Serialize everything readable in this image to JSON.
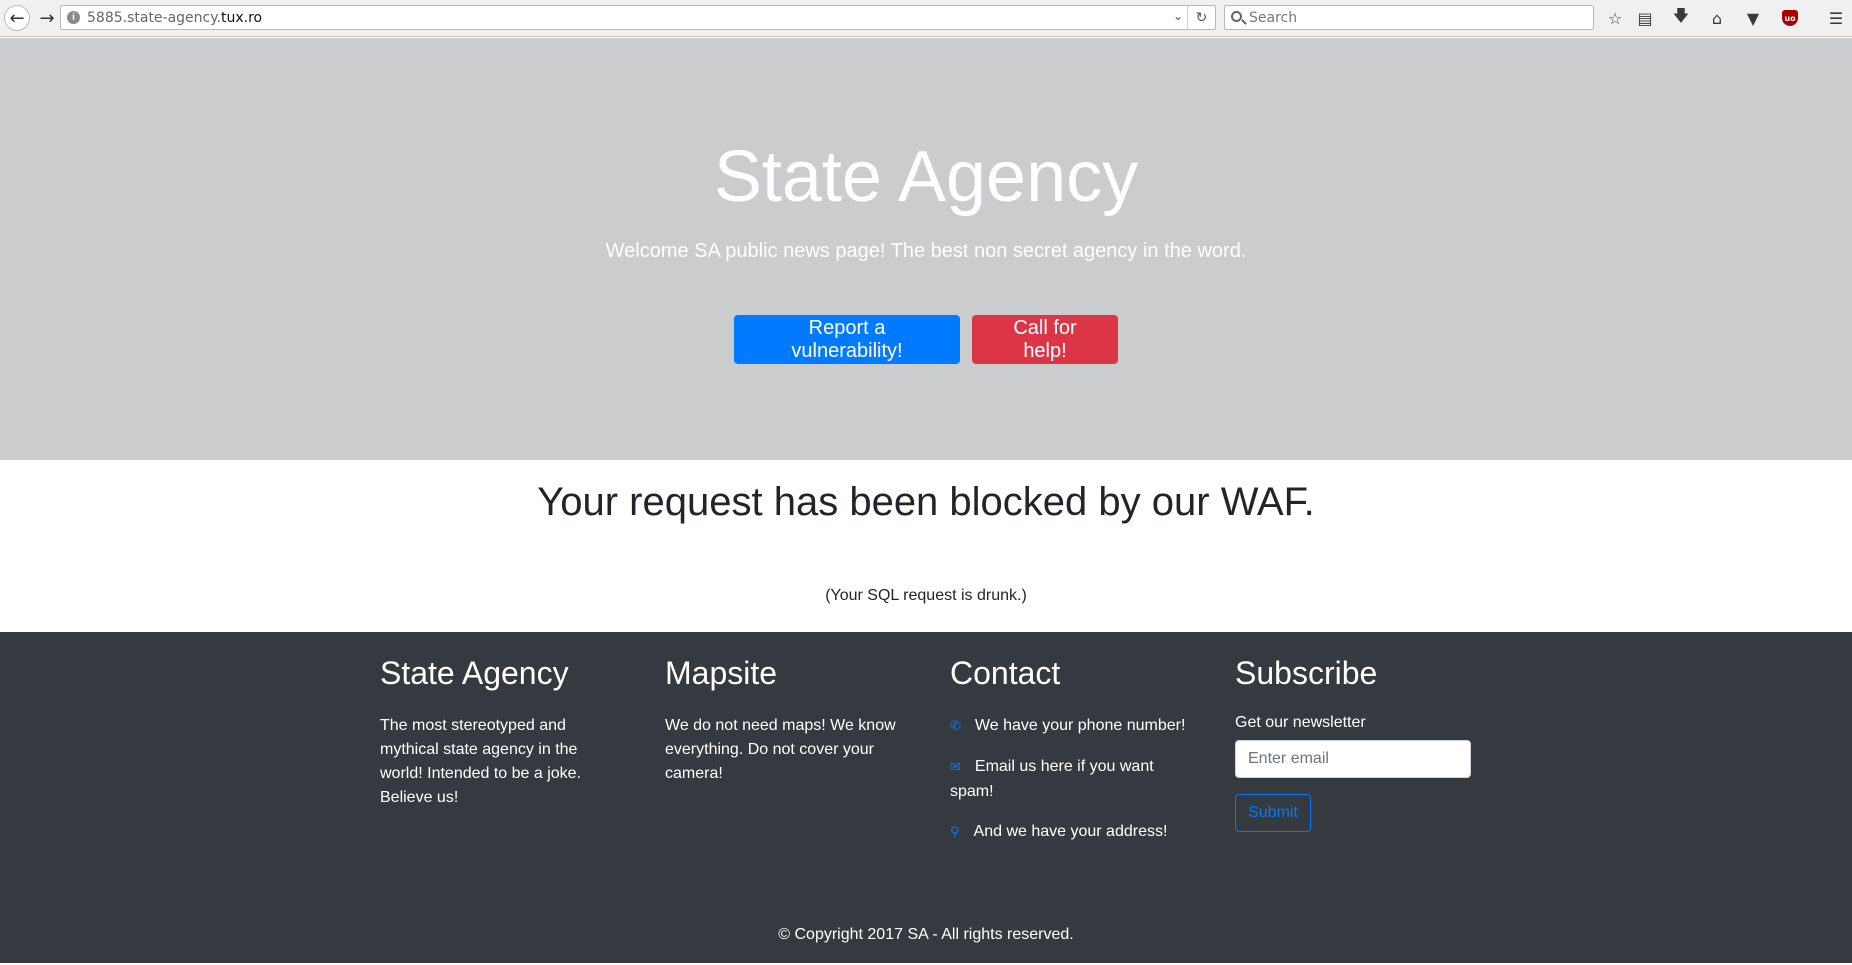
{
  "browser": {
    "url_prefix": "5885.state-agency.",
    "url_host": "tux.ro",
    "search_placeholder": "Search"
  },
  "hero": {
    "title": "State Agency",
    "lead": "Welcome SA public news page! The best non secret agency in the word.",
    "report_button": "Report a vulnerability!",
    "help_button": "Call for help!"
  },
  "main": {
    "title": "Your request has been blocked by our WAF.",
    "subtitle": "(Your SQL request is drunk.)"
  },
  "footer": {
    "about": {
      "title": "State Agency",
      "text": "The most stereotyped and mythical state agency in the world! Intended to be a joke. Believe us!"
    },
    "mapsite": {
      "title": "Mapsite",
      "text": "We do not need maps! We know everything. Do not cover your camera!"
    },
    "contact": {
      "title": "Contact",
      "items": [
        {
          "icon": "phone-icon",
          "text": "We have your phone number!"
        },
        {
          "icon": "envelope-icon",
          "text": "Email us here if you want spam!"
        },
        {
          "icon": "map-marker-icon",
          "text": "And we have your address!"
        }
      ]
    },
    "subscribe": {
      "title": "Subscribe",
      "label": "Get our newsletter",
      "email_placeholder": "Enter email",
      "submit_label": "Submit"
    },
    "copyright": "© Copyright 2017 SA - All rights reserved."
  },
  "colors": {
    "hero_bg": "#cbccce",
    "primary": "#007bff",
    "danger": "#dc3545",
    "footer_bg": "#343a40"
  }
}
